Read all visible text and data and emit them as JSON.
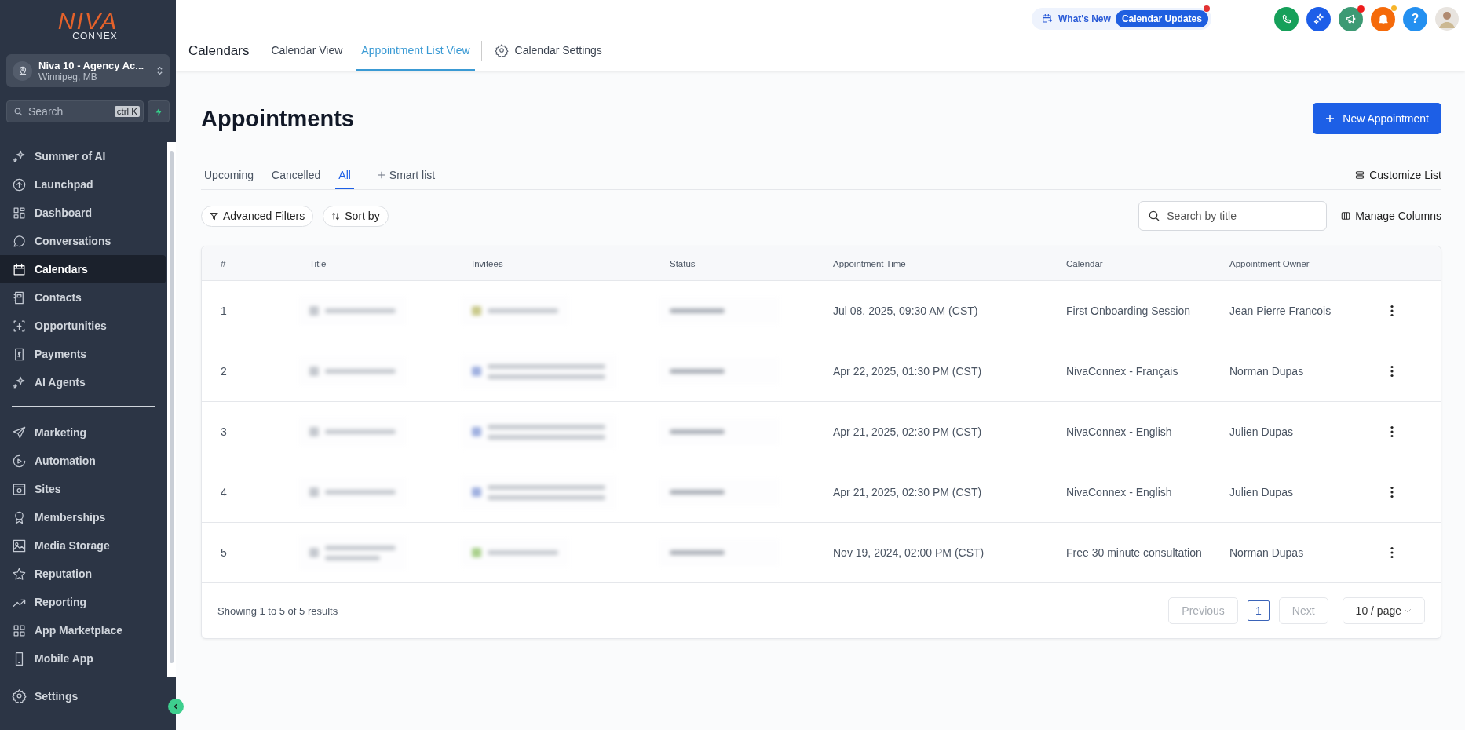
{
  "sidebar": {
    "logo": {
      "wordmark": "NIVA",
      "sub": "CONNEX"
    },
    "account": {
      "name": "Niva 10 - Agency Ac...",
      "location": "Winnipeg, MB"
    },
    "search": {
      "placeholder": "Search",
      "shortcut": "ctrl K"
    },
    "nav_groups": [
      [
        {
          "label": "Summer of AI",
          "selected": false
        },
        {
          "label": "Launchpad",
          "selected": false
        },
        {
          "label": "Dashboard",
          "selected": false
        },
        {
          "label": "Conversations",
          "selected": false
        },
        {
          "label": "Calendars",
          "selected": true
        },
        {
          "label": "Contacts",
          "selected": false
        },
        {
          "label": "Opportunities",
          "selected": false
        },
        {
          "label": "Payments",
          "selected": false
        },
        {
          "label": "AI Agents",
          "selected": false
        }
      ],
      [
        {
          "label": "Marketing",
          "selected": false
        },
        {
          "label": "Automation",
          "selected": false
        },
        {
          "label": "Sites",
          "selected": false
        },
        {
          "label": "Memberships",
          "selected": false
        },
        {
          "label": "Media Storage",
          "selected": false
        },
        {
          "label": "Reputation",
          "selected": false
        },
        {
          "label": "Reporting",
          "selected": false
        },
        {
          "label": "App Marketplace",
          "selected": false
        },
        {
          "label": "Mobile App",
          "selected": false
        }
      ]
    ],
    "settings": {
      "label": "Settings"
    }
  },
  "topbar": {
    "whats_new": {
      "label": "What's New",
      "badge": "Calendar Updates",
      "dot": true
    },
    "actions": [
      {
        "color": "#16a05a",
        "dot": false
      },
      {
        "color": "#1d5ee8",
        "dot": false
      },
      {
        "color": "#3d9a74",
        "dot": true
      },
      {
        "color": "#f56a0a",
        "dot": true
      },
      {
        "color": "#2490f0",
        "dot": false,
        "label": "?"
      }
    ]
  },
  "header": {
    "title": "Calendars",
    "tabs": [
      {
        "label": "Calendar View",
        "selected": false
      },
      {
        "label": "Appointment List View",
        "selected": true
      }
    ],
    "settings_link": "Calendar Settings"
  },
  "page": {
    "title": "Appointments",
    "new_button": "New Appointment",
    "list_tabs": [
      {
        "label": "Upcoming",
        "selected": false
      },
      {
        "label": "Cancelled",
        "selected": false
      },
      {
        "label": "All",
        "selected": true
      }
    ],
    "smart_list": "Smart list",
    "customize": "Customize List",
    "advanced_filters": "Advanced Filters",
    "sort_by": "Sort by",
    "search": {
      "placeholder": "Search by title"
    },
    "manage_columns": "Manage Columns"
  },
  "table": {
    "columns": [
      "#",
      "Title",
      "Invitees",
      "Status",
      "Appointment Time",
      "Calendar",
      "Appointment Owner"
    ],
    "rows": [
      {
        "number": "1",
        "time": "Jul 08, 2025, 09:30 AM (CST)",
        "calendar": "First Onboarding Session",
        "owner": "Jean Pierre Francois"
      },
      {
        "number": "2",
        "time": "Apr 22, 2025, 01:30 PM (CST)",
        "calendar": "NivaConnex - Français",
        "owner": "Norman Dupas"
      },
      {
        "number": "3",
        "time": "Apr 21, 2025, 02:30 PM (CST)",
        "calendar": "NivaConnex - English",
        "owner": "Julien Dupas"
      },
      {
        "number": "4",
        "time": "Apr 21, 2025, 02:30 PM (CST)",
        "calendar": "NivaConnex - English",
        "owner": "Julien Dupas"
      },
      {
        "number": "5",
        "time": "Nov 19, 2024, 02:00 PM (CST)",
        "calendar": "Free 30 minute consultation",
        "owner": "Norman Dupas"
      }
    ],
    "summary": "Showing 1 to 5 of 5 results",
    "pagination": {
      "previous": "Previous",
      "pages": [
        {
          "label": "1",
          "selected": true
        }
      ],
      "next": "Next",
      "page_size": "10 / page"
    }
  }
}
